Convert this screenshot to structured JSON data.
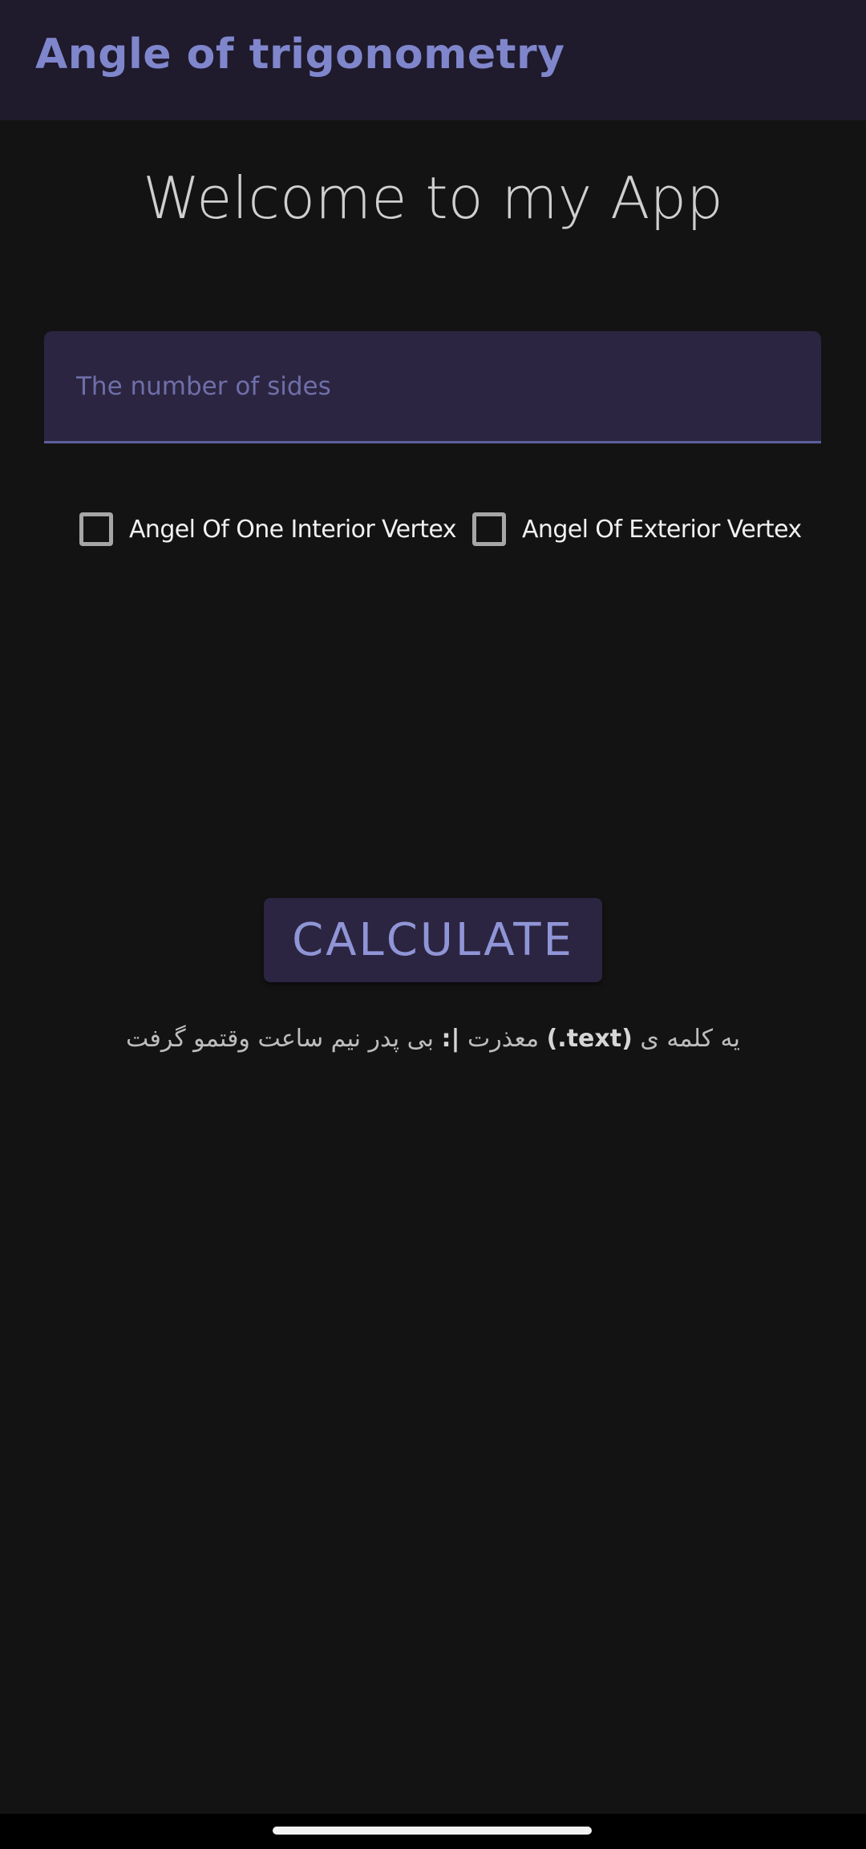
{
  "app_bar": {
    "title": "Angle of trigonometry"
  },
  "main": {
    "welcome": "Welcome to my App",
    "sides_input": {
      "placeholder": "The number of sides",
      "value": ""
    },
    "checkboxes": [
      {
        "label": "Angel Of One Interior Vertex",
        "checked": false
      },
      {
        "label": "Angel Of Exterior Vertex",
        "checked": false
      }
    ],
    "calculate_label": "CALCULATE",
    "status": {
      "prefix": "یه کلمه ی ",
      "code": "(.text)",
      "middle": " معذرت ",
      "emoticon": ":|",
      "suffix": " بی پدر نیم ساعت وقتمو گرفت"
    }
  },
  "colors": {
    "background": "#131313",
    "app_bar": "#1f1a2c",
    "accent": "#7f86cc",
    "input_fill": "#2c2541",
    "input_underline": "#5e5f9e"
  }
}
